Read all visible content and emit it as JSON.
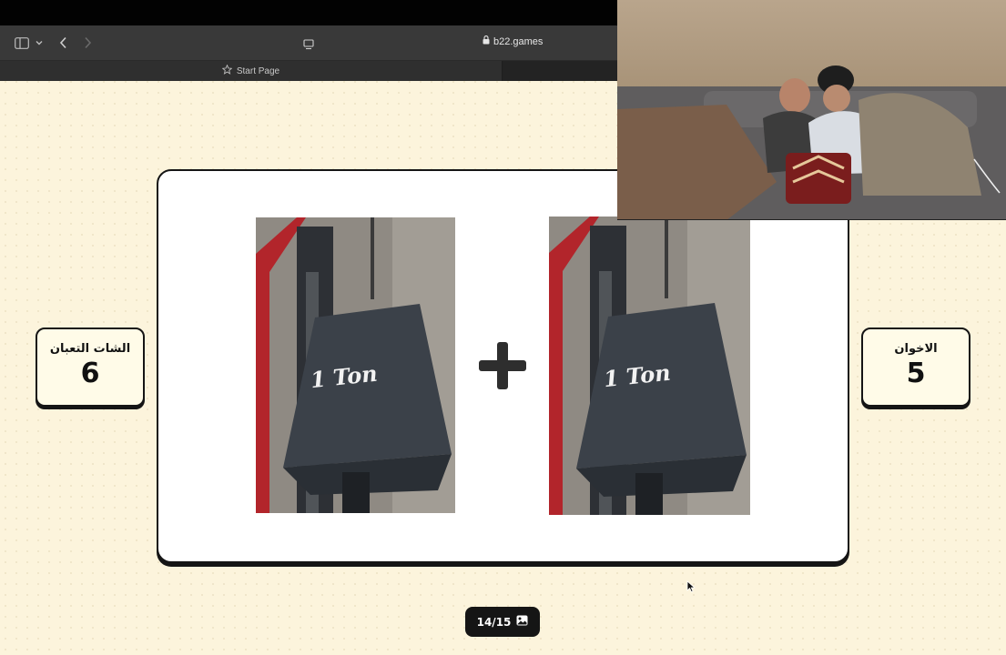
{
  "browser": {
    "url": "b22.games",
    "tab_label": "Start Page"
  },
  "game": {
    "team_left": {
      "name": "الشات التعبان",
      "score": "6"
    },
    "team_right": {
      "name": "الاخوان",
      "score": "5"
    },
    "puzzle": {
      "left_image_text": "1 Ton",
      "right_image_text": "1 Ton"
    },
    "counter": "14/15"
  }
}
